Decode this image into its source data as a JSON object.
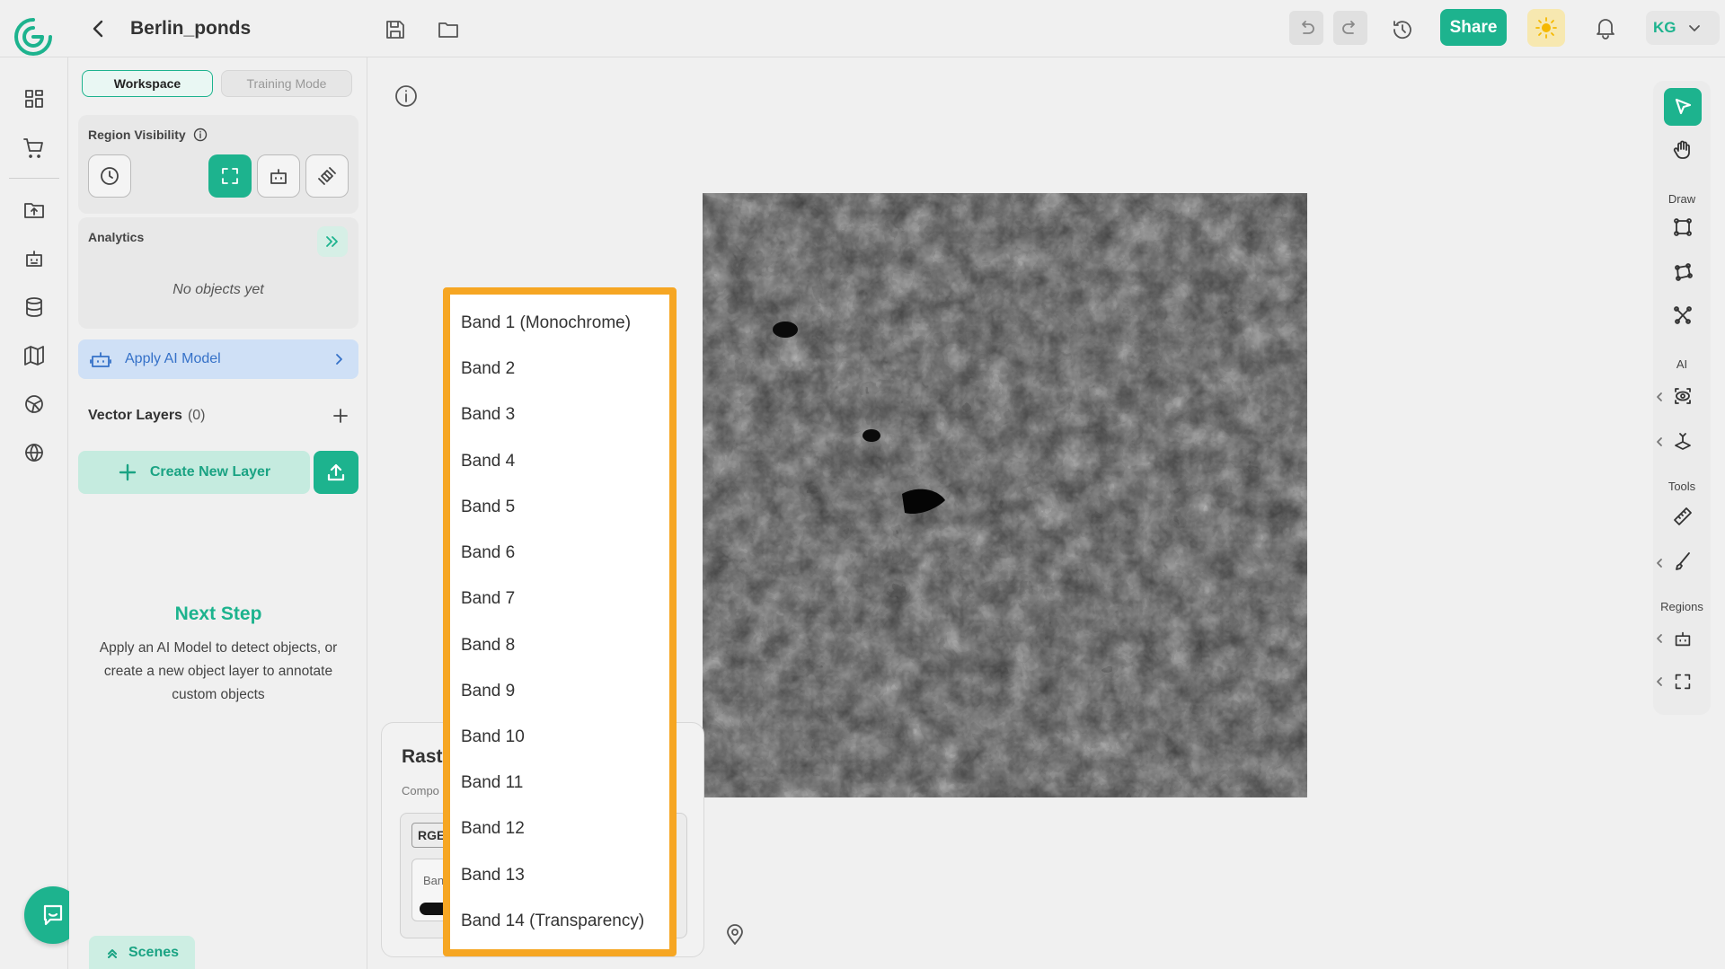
{
  "header": {
    "project_title": "Berlin_ponds",
    "share_label": "Share",
    "user_initials": "KG"
  },
  "sidepanel": {
    "mode_workspace": "Workspace",
    "mode_training": "Training Mode",
    "region_visibility_title": "Region Visibility",
    "analytics_title": "Analytics",
    "analytics_empty": "No objects yet",
    "apply_ai_label": "Apply AI Model",
    "vector_layers_title": "Vector Layers",
    "vector_layers_count": "(0)",
    "create_layer_label": "Create New Layer",
    "next_step_title": "Next Step",
    "next_step_text": "Apply an AI Model to detect objects, or create a new object layer to annotate custom objects",
    "scenes_label": "Scenes"
  },
  "raster_panel": {
    "title": "Rast",
    "subtitle": "Compo",
    "rgb_tag": "RGE",
    "band_row_label": "Ban"
  },
  "band_dropdown": {
    "options": [
      "Band 1 (Monochrome)",
      "Band 2",
      "Band 3",
      "Band 4",
      "Band 5",
      "Band 6",
      "Band 7",
      "Band 8",
      "Band 9",
      "Band 10",
      "Band 11",
      "Band 12",
      "Band 13",
      "Band 14 (Transparency)"
    ]
  },
  "right_toolbar": {
    "draw_label": "Draw",
    "ai_label": "AI",
    "tools_label": "Tools",
    "regions_label": "Regions"
  },
  "colors": {
    "accent": "#1db38e",
    "dropdown_border": "#f6a623",
    "ai_button_bg": "#cfe0f6",
    "ai_button_text": "#3571c8"
  }
}
